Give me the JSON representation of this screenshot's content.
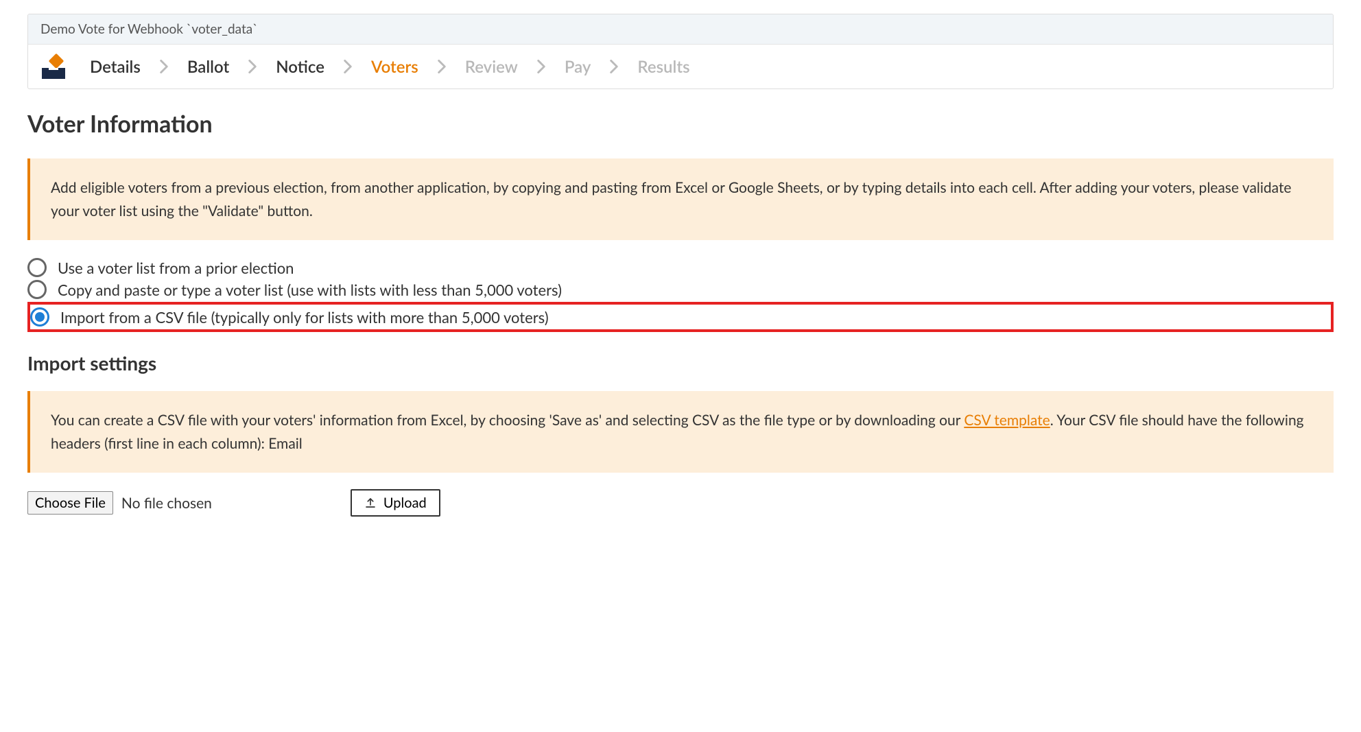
{
  "card": {
    "title": "Demo Vote for Webhook `voter_data`"
  },
  "steps": [
    {
      "label": "Details",
      "state": ""
    },
    {
      "label": "Ballot",
      "state": ""
    },
    {
      "label": "Notice",
      "state": ""
    },
    {
      "label": "Voters",
      "state": "active"
    },
    {
      "label": "Review",
      "state": "disabled"
    },
    {
      "label": "Pay",
      "state": "disabled"
    },
    {
      "label": "Results",
      "state": "disabled"
    }
  ],
  "section_title": "Voter Information",
  "infobox1": "Add eligible voters from a previous election, from another application, by copying and pasting from Excel or Google Sheets, or by typing details into each cell. After adding your voters, please validate your voter list using the \"Validate\" button.",
  "radio_options": [
    {
      "label": "Use a voter list from a prior election",
      "checked": false,
      "highlight": false
    },
    {
      "label": "Copy and paste or type a voter list (use with lists with less than 5,000 voters)",
      "checked": false,
      "highlight": false
    },
    {
      "label": "Import from a CSV file (typically only for lists with more than 5,000 voters)",
      "checked": true,
      "highlight": true
    }
  ],
  "subsection_title": "Import settings",
  "infobox2": {
    "pre": "You can create a CSV file with your voters' information from Excel, by choosing 'Save as' and selecting CSV as the file type or by downloading our ",
    "link": "CSV template",
    "post": ". Your CSV file should have the following headers (first line in each column): Email"
  },
  "file_picker": {
    "button": "Choose File",
    "status": "No file chosen",
    "upload": "Upload"
  }
}
